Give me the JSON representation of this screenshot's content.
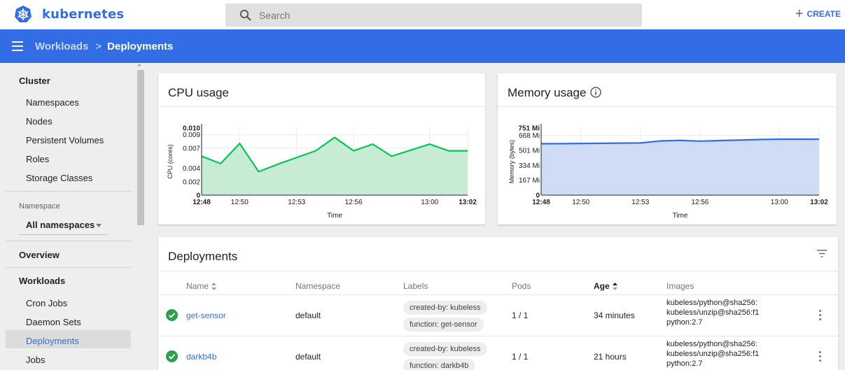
{
  "app": {
    "name": "kubernetes",
    "create_label": "CREATE"
  },
  "search": {
    "placeholder": "Search"
  },
  "breadcrumb": {
    "parent": "Workloads",
    "separator": ">",
    "current": "Deployments"
  },
  "sidebar": {
    "cluster": {
      "heading": "Cluster",
      "items": [
        "Namespaces",
        "Nodes",
        "Persistent Volumes",
        "Roles",
        "Storage Classes"
      ]
    },
    "namespace": {
      "label": "Namespace",
      "selected": "All namespaces"
    },
    "overview": "Overview",
    "workloads": {
      "heading": "Workloads",
      "items": [
        "Cron Jobs",
        "Daemon Sets",
        "Deployments",
        "Jobs"
      ],
      "active": "Deployments"
    }
  },
  "cpu_card": {
    "title": "CPU usage"
  },
  "memory_card": {
    "title": "Memory usage"
  },
  "chart_data": [
    {
      "type": "area",
      "title": "CPU usage",
      "xlabel": "Time",
      "ylabel": "CPU (cores)",
      "x_ticks": [
        "12:48",
        "12:50",
        "12:53",
        "12:56",
        "13:00",
        "13:02"
      ],
      "x_bold_ticks": [
        "12:48",
        "13:02"
      ],
      "y_ticks": [
        {
          "value": 0,
          "label": "0",
          "bold": true
        },
        {
          "value": 0.002,
          "label": "0.002",
          "bold": false
        },
        {
          "value": 0.004,
          "label": "0.004",
          "bold": false
        },
        {
          "value": 0.007,
          "label": "0.007",
          "bold": false
        },
        {
          "value": 0.009,
          "label": "0.009",
          "bold": false
        },
        {
          "value": 0.01,
          "label": "0.010",
          "bold": true
        }
      ],
      "ylim": [
        0,
        0.01
      ],
      "series": [
        {
          "color": "#00c853",
          "fill": "#c8ecd3",
          "x": [
            "12:48",
            "12:49",
            "12:50",
            "12:51",
            "12:52",
            "12:53",
            "12:54",
            "12:55",
            "12:56",
            "12:57",
            "12:58",
            "12:59",
            "13:00",
            "13:01",
            "13:02"
          ],
          "values": [
            0.0058,
            0.0047,
            0.0077,
            0.0035,
            0.0046,
            0.0056,
            0.0066,
            0.0086,
            0.0066,
            0.0076,
            0.0058,
            0.0067,
            0.0076,
            0.0066,
            0.0066
          ]
        }
      ]
    },
    {
      "type": "area",
      "title": "Memory usage",
      "xlabel": "Time",
      "ylabel": "Memory (bytes)",
      "x_ticks": [
        "12:48",
        "12:50",
        "12:53",
        "12:56",
        "13:00",
        "13:02"
      ],
      "x_bold_ticks": [
        "12:48",
        "13:02"
      ],
      "y_ticks": [
        {
          "value": 0,
          "label": "0",
          "bold": true
        },
        {
          "value": 167,
          "label": "167 Mi",
          "bold": false
        },
        {
          "value": 334,
          "label": "334 Mi",
          "bold": false
        },
        {
          "value": 501,
          "label": "501 Mi",
          "bold": false
        },
        {
          "value": 668,
          "label": "668 Mi",
          "bold": false
        },
        {
          "value": 751,
          "label": "751 Mi",
          "bold": true
        }
      ],
      "ylim": [
        0,
        751
      ],
      "series": [
        {
          "color": "#326de6",
          "fill": "#d0dcf5",
          "x": [
            "12:48",
            "12:49",
            "12:50",
            "12:51",
            "12:52",
            "12:53",
            "12:54",
            "12:55",
            "12:56",
            "12:57",
            "12:58",
            "12:59",
            "13:00",
            "13:01",
            "13:02"
          ],
          "values": [
            575,
            576,
            578,
            580,
            582,
            584,
            606,
            612,
            604,
            610,
            616,
            622,
            626,
            626,
            626
          ]
        }
      ]
    }
  ],
  "deployments": {
    "title": "Deployments",
    "columns": {
      "name": "Name",
      "namespace": "Namespace",
      "labels": "Labels",
      "pods": "Pods",
      "age": "Age",
      "images": "Images"
    },
    "rows": [
      {
        "name": "get-sensor",
        "namespace": "default",
        "labels": [
          "created-by: kubeless",
          "function: get-sensor"
        ],
        "pods": "1 / 1",
        "age": "34 minutes",
        "images": [
          "kubeless/python@sha256:",
          "kubeless/unzip@sha256:f1",
          "python:2.7"
        ],
        "status_color": "#2e9e4f"
      },
      {
        "name": "darkb4b",
        "namespace": "default",
        "labels": [
          "created-by: kubeless",
          "function: darkb4b"
        ],
        "pods": "1 / 1",
        "age": "21 hours",
        "images": [
          "kubeless/python@sha256:",
          "kubeless/unzip@sha256:f1",
          "python:2.7"
        ],
        "status_color": "#2e9e4f"
      }
    ]
  },
  "colors": {
    "accent": "#326de6",
    "ok": "#2e9e4f"
  }
}
